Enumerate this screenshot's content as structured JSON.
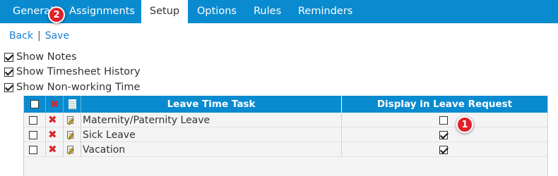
{
  "tabs": [
    {
      "label": "General",
      "active": false
    },
    {
      "label": "Assignments",
      "active": false
    },
    {
      "label": "Setup",
      "active": true
    },
    {
      "label": "Options",
      "active": false
    },
    {
      "label": "Rules",
      "active": false
    },
    {
      "label": "Reminders",
      "active": false
    }
  ],
  "nav": {
    "back": "Back",
    "separator": "|",
    "save": "Save"
  },
  "options": [
    {
      "label": "Show Notes",
      "checked": true
    },
    {
      "label": "Show Timesheet History",
      "checked": true
    },
    {
      "label": "Show Non-working Time",
      "checked": true
    }
  ],
  "grid": {
    "columns": {
      "task": "Leave Time Task",
      "display": "Display in Leave Request"
    },
    "header_icons": [
      "select-all-checkbox",
      "delete-icon",
      "list-icon"
    ],
    "rows": [
      {
        "task": "Maternity/Paternity Leave",
        "selected": false,
        "display": false
      },
      {
        "task": "Sick Leave",
        "selected": false,
        "display": true
      },
      {
        "task": "Vacation",
        "selected": false,
        "display": true
      }
    ]
  },
  "badges": {
    "one": "1",
    "two": "2"
  },
  "colors": {
    "tab_bar": "#0a8bd0",
    "link": "#1b7fcf",
    "badge": "#e0212a",
    "delete_icon": "#d8262b"
  }
}
